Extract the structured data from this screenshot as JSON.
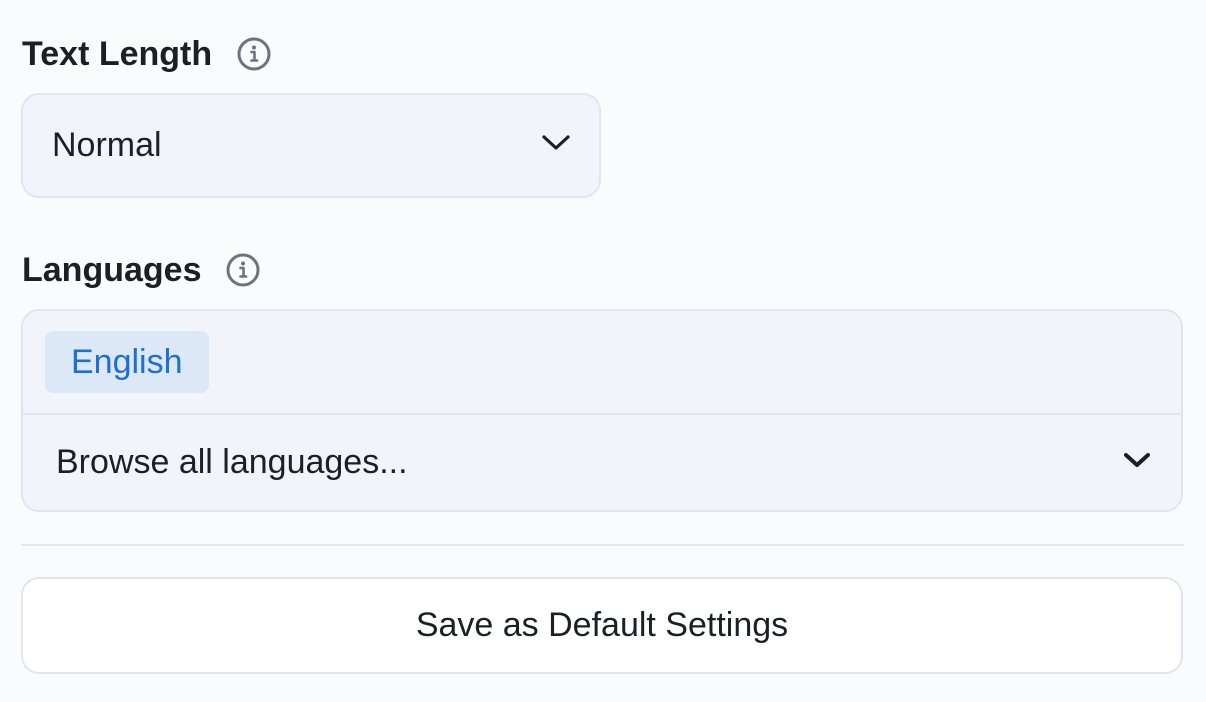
{
  "text_length": {
    "label": "Text Length",
    "info_icon": "info-circle-icon",
    "selected_value": "Normal",
    "dropdown_icon": "chevron-down-icon"
  },
  "languages": {
    "label": "Languages",
    "info_icon": "info-circle-icon",
    "selected": [
      "English"
    ],
    "browse_label": "Browse all languages...",
    "dropdown_icon": "chevron-down-icon"
  },
  "actions": {
    "save_default_label": "Save as Default Settings"
  },
  "colors": {
    "background": "#fafbfd",
    "field_background": "#f2f4fc",
    "border": "#e2e5ef",
    "chip_background": "#dce8f8",
    "chip_text": "#1d6fd6",
    "text": "#1c1f26",
    "icon": "#6b7280"
  }
}
